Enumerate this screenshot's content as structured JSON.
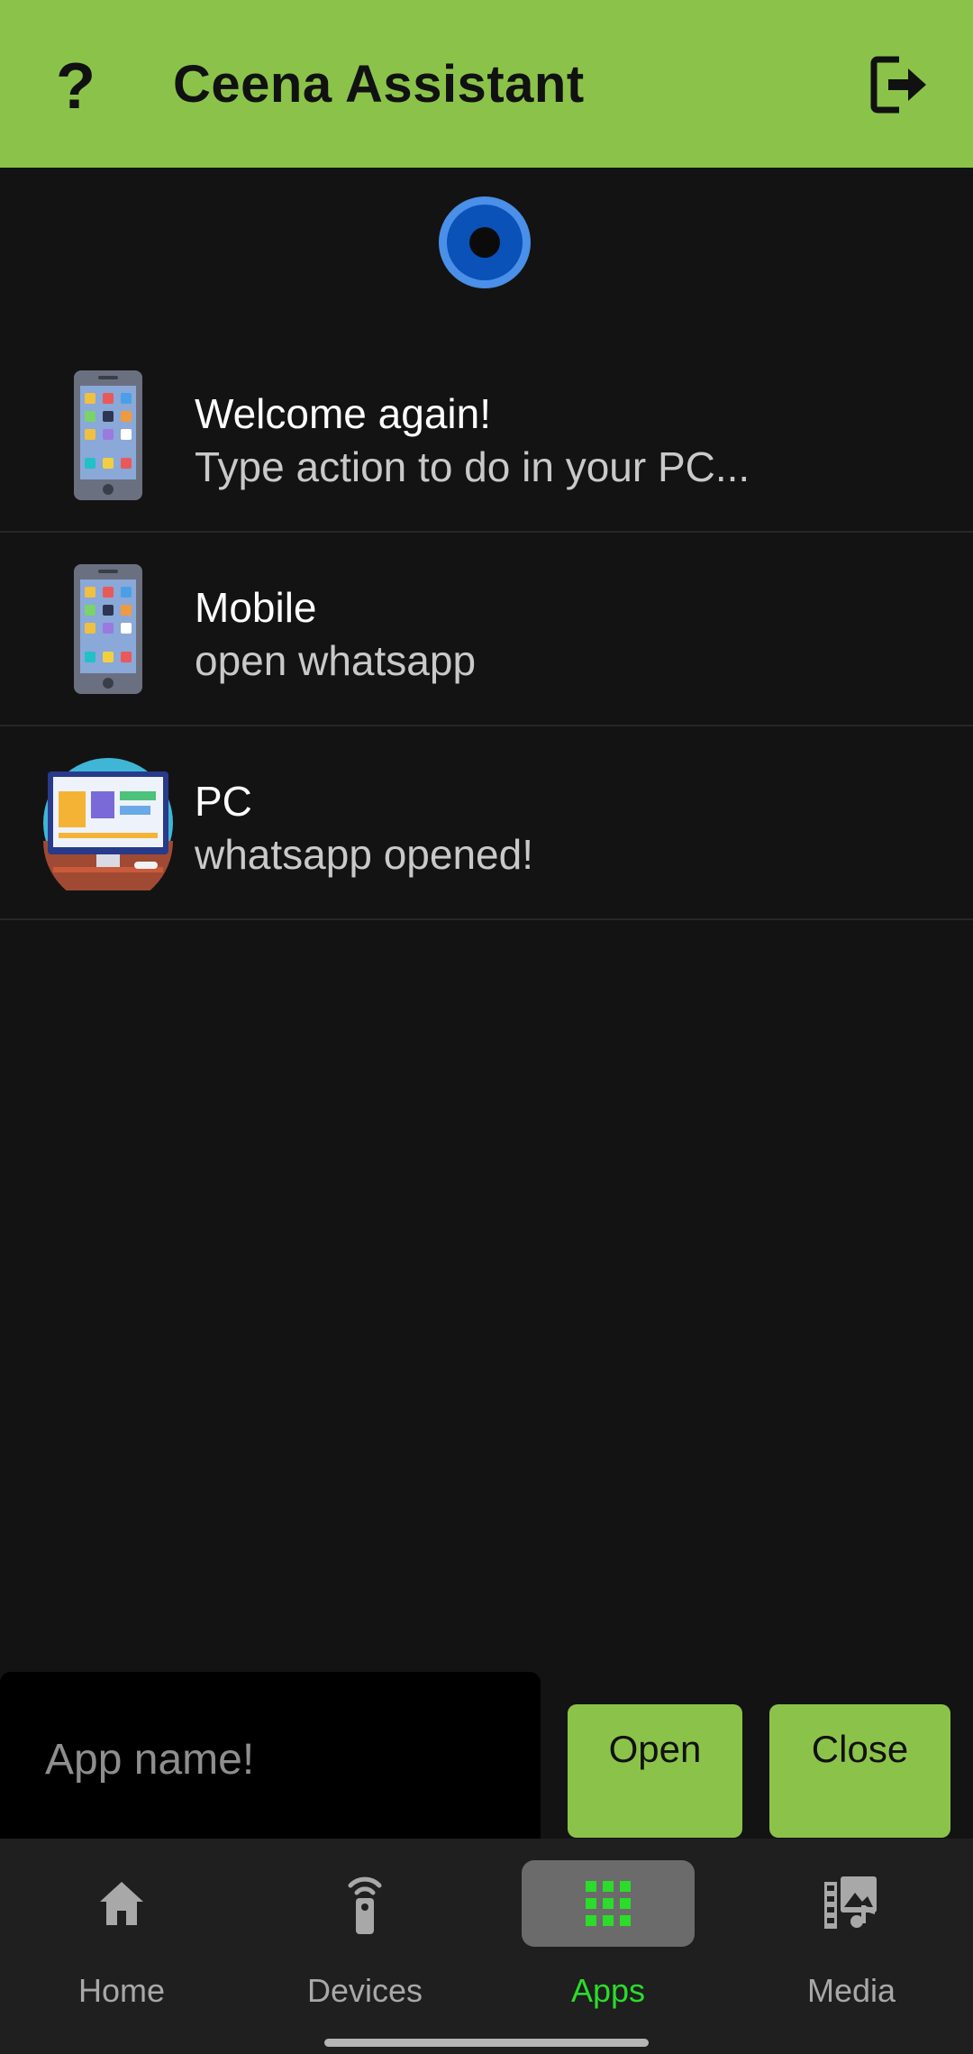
{
  "app": {
    "title": "Ceena Assistant",
    "help_label": "?",
    "brand_color": "#8bc34a",
    "mic_color": "#0a51b8"
  },
  "messages": [
    {
      "icon": "phone-icon",
      "name": "Welcome again!",
      "text": "Type action to do in your PC..."
    },
    {
      "icon": "phone-icon",
      "name": "Mobile",
      "text": "open whatsapp"
    },
    {
      "icon": "pc-icon",
      "name": "PC",
      "text": "whatsapp opened!"
    }
  ],
  "input": {
    "placeholder": "App name!",
    "value": ""
  },
  "buttons": {
    "open": "Open",
    "close": "Close"
  },
  "nav": {
    "items": [
      {
        "label": "Home",
        "icon": "home-icon",
        "active": false
      },
      {
        "label": "Devices",
        "icon": "devices-icon",
        "active": false
      },
      {
        "label": "Apps",
        "icon": "apps-grid-icon",
        "active": true
      },
      {
        "label": "Media",
        "icon": "media-icon",
        "active": false
      }
    ],
    "active_color": "#2bdc2b"
  }
}
